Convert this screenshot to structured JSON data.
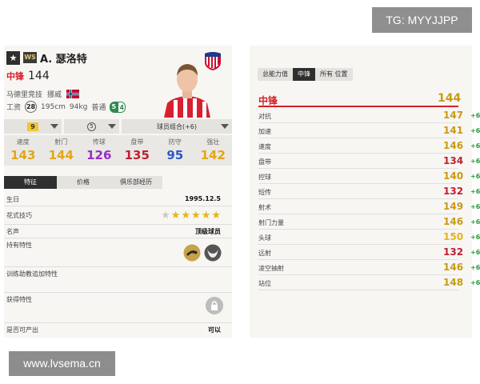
{
  "watermarks": {
    "telegram": "TG: MYYJJPP",
    "site": "www.lvsema.cn"
  },
  "player": {
    "name": "A. 瑟洛特",
    "season_badge": "WS",
    "position": "中锋",
    "overall": "144",
    "club": "马德里竞技",
    "nation": "挪威",
    "wage_label": "工资",
    "wage": "28",
    "height": "195cm",
    "weight": "94kg",
    "body_type": "普通",
    "weak_foot": "5",
    "strong_foot": "4"
  },
  "selectors": {
    "level": "9",
    "boost": "5",
    "chemistry": "球员组合(+6)"
  },
  "summary_stats": [
    {
      "label": "速度",
      "value": "143",
      "color": "#e3a51a"
    },
    {
      "label": "射门",
      "value": "144",
      "color": "#e3a51a"
    },
    {
      "label": "传球",
      "value": "126",
      "color": "#9b2bc7"
    },
    {
      "label": "盘带",
      "value": "135",
      "color": "#c21f31"
    },
    {
      "label": "防守",
      "value": "95",
      "color": "#2d58c9"
    },
    {
      "label": "强壮",
      "value": "142",
      "color": "#e3a51a"
    }
  ],
  "detail_tabs": [
    "特征",
    "价格",
    "俱乐部经历"
  ],
  "details": {
    "birth_label": "生日",
    "birth": "1995.12.5",
    "skill_label": "花式技巧",
    "skill_stars": 5,
    "fame_label": "名声",
    "fame": "顶级球员",
    "traits_label": "持有特性",
    "training_label": "训练助教追加特性",
    "acquired_label": "获得特性",
    "producible_label": "是否可产出",
    "producible": "可以"
  },
  "right_tabs": [
    "总能力值",
    "中锋",
    "所有 位置"
  ],
  "position_rating": {
    "label": "中锋",
    "value": "144"
  },
  "attributes": [
    {
      "label": "对抗",
      "value": "147",
      "bonus": "+6",
      "color": "#c99a12"
    },
    {
      "label": "加速",
      "value": "141",
      "bonus": "+6",
      "color": "#c99a12"
    },
    {
      "label": "速度",
      "value": "146",
      "bonus": "+6",
      "color": "#c99a12"
    },
    {
      "label": "盘带",
      "value": "134",
      "bonus": "+6",
      "color": "#c21f31"
    },
    {
      "label": "控球",
      "value": "140",
      "bonus": "+6",
      "color": "#c99a12"
    },
    {
      "label": "短传",
      "value": "132",
      "bonus": "+6",
      "color": "#c21f31"
    },
    {
      "label": "射术",
      "value": "149",
      "bonus": "+6",
      "color": "#c99a12"
    },
    {
      "label": "射门力量",
      "value": "146",
      "bonus": "+6",
      "color": "#c99a12"
    },
    {
      "label": "头球",
      "value": "150",
      "bonus": "+6",
      "color": "#e3b518"
    },
    {
      "label": "远射",
      "value": "132",
      "bonus": "+6",
      "color": "#c21f31"
    },
    {
      "label": "凌空抽射",
      "value": "146",
      "bonus": "+6",
      "color": "#c99a12"
    },
    {
      "label": "站位",
      "value": "148",
      "bonus": "+6",
      "color": "#c99a12"
    }
  ]
}
